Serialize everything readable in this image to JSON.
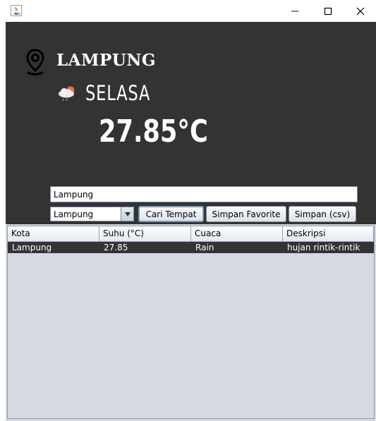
{
  "window": {
    "app_icon": "java-cup-icon",
    "controls": [
      "minimize-icon",
      "maximize-icon",
      "close-icon"
    ]
  },
  "header": {
    "location_icon": "map-pin-icon",
    "city": "LAMPUNG",
    "weather_icon": "cloud-sun-rain-icon",
    "day": "SELASA",
    "temperature": "27.85°C"
  },
  "search": {
    "value": "Lampung",
    "combo_value": "Lampung",
    "buttons": {
      "search": "Cari Tempat",
      "save_favorite": "Simpan Favorite",
      "save_csv": "Simpan (csv)"
    }
  },
  "table": {
    "columns": [
      "Kota",
      "Suhu (°C)",
      "Cuaca",
      "Deskripsi"
    ],
    "rows": [
      [
        "Lampung",
        "27.85",
        "Rain",
        "hujan rintik-rintik"
      ]
    ]
  }
}
